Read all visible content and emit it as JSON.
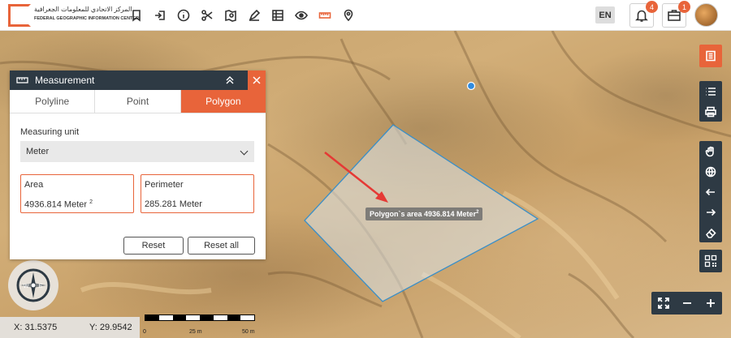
{
  "header": {
    "logo_ar": "المركز الاتحادي للمعلومات الجغرافية",
    "logo_en": "FEDERAL GEOGRAPHIC INFORMATION CENTER",
    "language": "EN",
    "notifications_count": "4",
    "inbox_count": "1",
    "tools": [
      "bookmark-icon",
      "import-icon",
      "info-icon",
      "scissors-icon",
      "map-search-icon",
      "draw-icon",
      "table-icon",
      "eye-icon",
      "ruler-icon",
      "location-pin-icon"
    ],
    "active_tool": "ruler-icon"
  },
  "measurement": {
    "title": "Measurement",
    "tabs": [
      {
        "label": "Polyline",
        "active": false
      },
      {
        "label": "Point",
        "active": false
      },
      {
        "label": "Polygon",
        "active": true
      }
    ],
    "unit_label": "Measuring unit",
    "unit_value": "Meter",
    "area_label": "Area",
    "area_value": "4936.814 Meter",
    "area_sup": "2",
    "perimeter_label": "Perimeter",
    "perimeter_value": "285.281 Meter",
    "reset_label": "Reset",
    "reset_all_label": "Reset all"
  },
  "map": {
    "tooltip_text": "Polygon`s area 4936.814 Meter",
    "tooltip_sup": "2",
    "coord_x": "X: 31.5375",
    "coord_y": "Y: 29.9542",
    "compass_w": "W",
    "compass_e": "E",
    "scale_labels": [
      "0",
      "25 m",
      "50 m"
    ]
  },
  "colors": {
    "accent": "#e8643a",
    "dark_panel": "#2e3a44"
  }
}
